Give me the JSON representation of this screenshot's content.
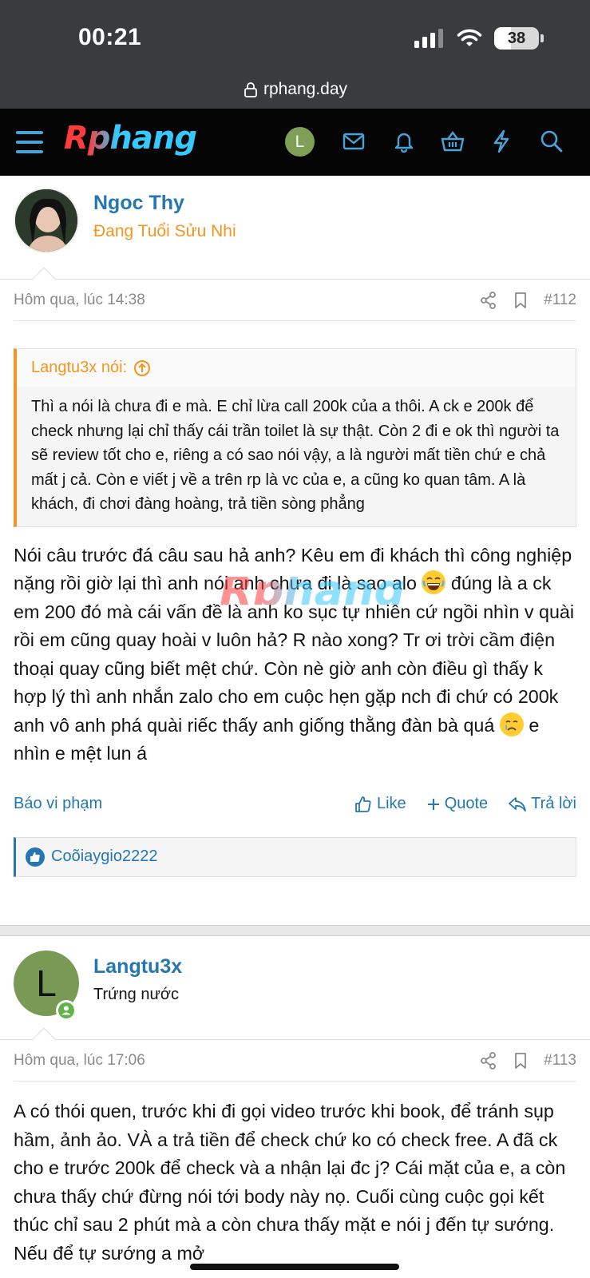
{
  "status_bar": {
    "time": "00:21",
    "battery": "38",
    "battery_level": 0.38
  },
  "browser": {
    "url": "rphang.day"
  },
  "header": {
    "logo": "Rphang",
    "user_initial": "L"
  },
  "watermark": "Rphang",
  "posts": [
    {
      "author": "Ngoc Thy",
      "author_title": "Đang Tuổi Sửu Nhi",
      "author_title_color": "#f7941d",
      "date": "Hôm qua, lúc 14:38",
      "number": "#112",
      "quote": {
        "author": "Langtu3x nói:",
        "text": "Thì a nói là chưa đi e mà. E chỉ lừa call 200k của a thôi. A ck e 200k để check nhưng lại chỉ thấy cái trần toilet là sự thật. Còn 2 đi e ok thì người ta sẽ review tốt cho e, riêng a có sao nói vậy, a là người mất tiền chứ e chả mất j cả. Còn e viết j về a trên rp là vc của e, a cũng ko quan tâm. A là khách, đi chơi đàng hoàng, trả tiền sòng phẳng"
      },
      "body_part1": "Nói câu trước đá câu sau hả anh? Kêu em đi khách thì công nghiệp nặng rồi giờ lại thì anh nói anh chưa đi là sao alo",
      "body_part2": " đúng là a ck em 200 đó mà cái vấn đề là anh ko sục tự nhiên cứ ngồi nhìn v quài rồi em cũng quay hoài v luôn hả? R nào xong? Tr ơi trời cầm điện thoại quay cũng biết mệt chứ. Còn nè giờ anh còn điều gì thấy k hợp lý thì anh nhắn zalo cho em cuộc hẹn gặp nch đi chứ có 200k anh vô anh phá quài riếc thấy anh giống thằng đàn bà quá",
      "body_part3": " e nhìn e mệt lun á",
      "actions": {
        "report": "Báo vi phạm",
        "like": "Like",
        "quote": "Quote",
        "reply": "Trả lời"
      },
      "reactions": "Coõiaygio2222"
    },
    {
      "author": "Langtu3x",
      "author_initial": "L",
      "author_title": "Trứng nước",
      "author_title_color": "#141414",
      "date": "Hôm qua, lúc 17:06",
      "number": "#113",
      "body": "A có thói quen, trước khi đi gọi video trước khi book, để tránh sụp hầm, ảnh ảo. VÀ a trả tiền để check chứ ko có check free. A đã ck cho e trước 200k để check và a nhận lại đc j? Cái mặt của e, a còn chưa thấy chứ đừng nói tới body này nọ. Cuối cùng cuộc gọi kết thúc chỉ sau 2 phút mà a còn chưa thấy mặt e nói j đến tự sướng. Nếu để tự sướng a mở"
    }
  ],
  "colors": {
    "link": "#2577b1",
    "accent": "#f7941d",
    "online": "#63b448"
  }
}
